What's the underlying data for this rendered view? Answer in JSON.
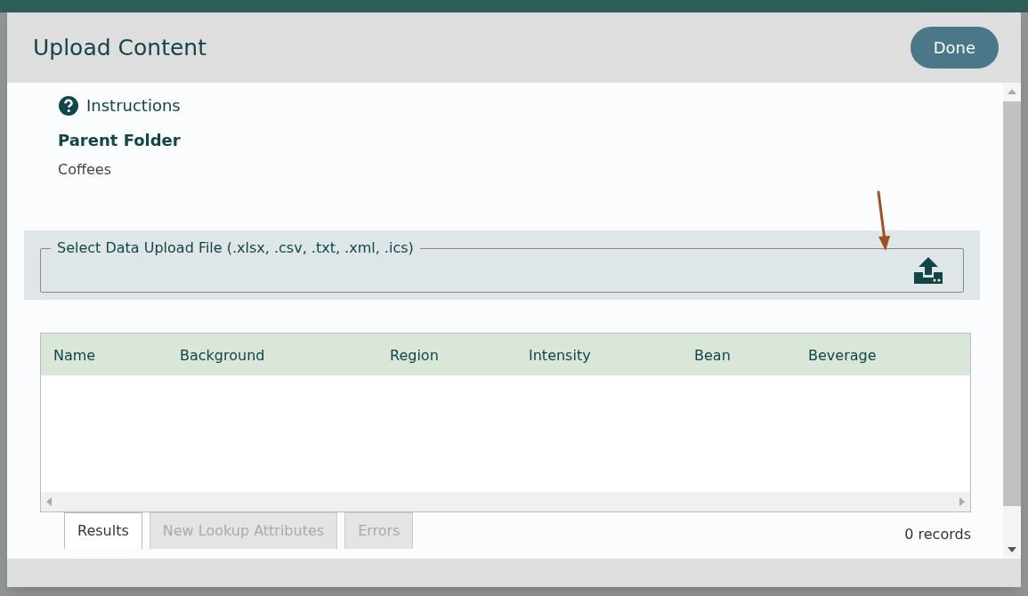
{
  "dialog": {
    "title": "Upload Content",
    "done_button": "Done"
  },
  "instructions": {
    "label": "Instructions"
  },
  "parent_folder": {
    "label": "Parent Folder",
    "value": "Coffees"
  },
  "upload": {
    "legend": "Select Data Upload File (.xlsx, .csv, .txt, .xml, .ics)"
  },
  "table": {
    "columns": [
      "Name",
      "Background",
      "Region",
      "Intensity",
      "Bean",
      "Beverage"
    ]
  },
  "tabs": [
    {
      "label": "Results",
      "selected": true
    },
    {
      "label": "New Lookup Attributes",
      "selected": false
    },
    {
      "label": "Errors",
      "selected": false
    }
  ],
  "record_count": "0 records"
}
